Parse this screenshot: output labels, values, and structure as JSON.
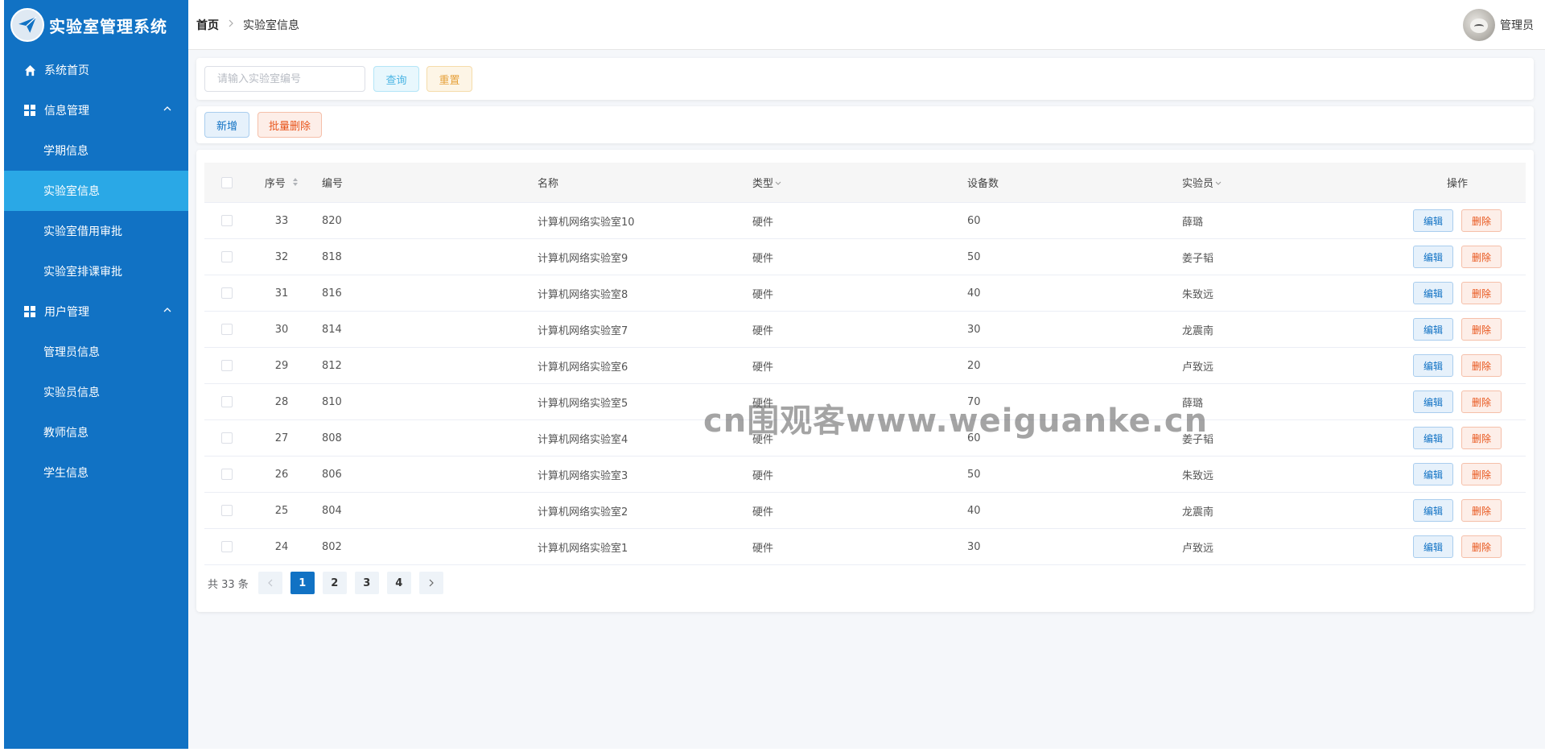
{
  "app": {
    "title": "实验室管理系统"
  },
  "sidebar": {
    "home": "系统首页",
    "groups": [
      {
        "label": "信息管理",
        "items": [
          "学期信息",
          "实验室信息",
          "实验室借用审批",
          "实验室排课审批"
        ]
      },
      {
        "label": "用户管理",
        "items": [
          "管理员信息",
          "实验员信息",
          "教师信息",
          "学生信息"
        ]
      }
    ]
  },
  "header": {
    "breadcrumb_home": "首页",
    "breadcrumb_current": "实验室信息",
    "user_name": "管理员"
  },
  "search": {
    "placeholder": "请输入实验室编号",
    "query_label": "查询",
    "reset_label": "重置"
  },
  "actions": {
    "add_label": "新增",
    "batch_delete_label": "批量删除"
  },
  "table": {
    "columns": [
      "序号",
      "编号",
      "名称",
      "类型",
      "设备数",
      "实验员",
      "操作"
    ],
    "edit_label": "编辑",
    "delete_label": "删除",
    "rows": [
      {
        "idx": "33",
        "code": "820",
        "name": "计算机网络实验室10",
        "type": "硬件",
        "devices": "60",
        "staff": "薛璐"
      },
      {
        "idx": "32",
        "code": "818",
        "name": "计算机网络实验室9",
        "type": "硬件",
        "devices": "50",
        "staff": "姜子韬"
      },
      {
        "idx": "31",
        "code": "816",
        "name": "计算机网络实验室8",
        "type": "硬件",
        "devices": "40",
        "staff": "朱致远"
      },
      {
        "idx": "30",
        "code": "814",
        "name": "计算机网络实验室7",
        "type": "硬件",
        "devices": "30",
        "staff": "龙震南"
      },
      {
        "idx": "29",
        "code": "812",
        "name": "计算机网络实验室6",
        "type": "硬件",
        "devices": "20",
        "staff": "卢致远"
      },
      {
        "idx": "28",
        "code": "810",
        "name": "计算机网络实验室5",
        "type": "硬件",
        "devices": "70",
        "staff": "薛璐"
      },
      {
        "idx": "27",
        "code": "808",
        "name": "计算机网络实验室4",
        "type": "硬件",
        "devices": "60",
        "staff": "姜子韬"
      },
      {
        "idx": "26",
        "code": "806",
        "name": "计算机网络实验室3",
        "type": "硬件",
        "devices": "50",
        "staff": "朱致远"
      },
      {
        "idx": "25",
        "code": "804",
        "name": "计算机网络实验室2",
        "type": "硬件",
        "devices": "40",
        "staff": "龙震南"
      },
      {
        "idx": "24",
        "code": "802",
        "name": "计算机网络实验室1",
        "type": "硬件",
        "devices": "30",
        "staff": "卢致远"
      }
    ]
  },
  "pagination": {
    "total_text": "共 33 条",
    "pages": [
      "1",
      "2",
      "3",
      "4"
    ],
    "current": "1"
  },
  "watermark": "cn围观客www.weiguanke.cn",
  "colors": {
    "sidebar_bg": "#1172c4",
    "sidebar_active": "#2aa8e6",
    "primary": "#1172c4",
    "danger": "#e8541a",
    "warning": "#e6a23c",
    "info": "#4ab4e4"
  },
  "icons": {
    "logo": "paper-plane-icon",
    "home": "home-icon",
    "menu_group": "grid-icon",
    "expand": "chevron-up-icon",
    "breadcrumb_sep": "chevron-right-icon",
    "sort": "sort-caret-icon",
    "filter": "chevron-down-icon",
    "prev": "chevron-left-icon",
    "next": "chevron-right-icon"
  }
}
